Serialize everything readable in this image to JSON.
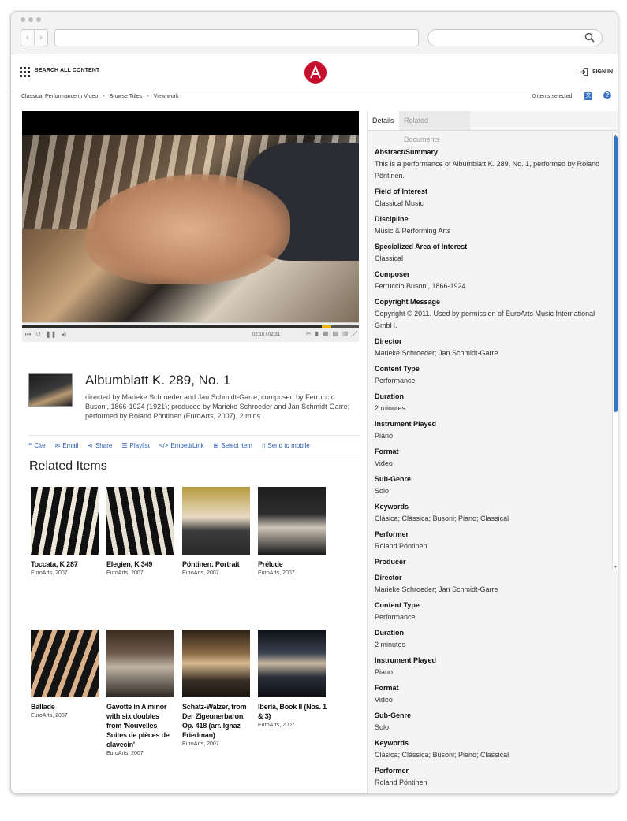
{
  "browser": {
    "url": "",
    "search": ""
  },
  "header": {
    "search_all": "SEARCH ALL CONTENT",
    "sign_in": "SIGN IN"
  },
  "breadcrumb": [
    "Classical Performance in Video",
    "Browse Titles",
    "View work"
  ],
  "items_selected": "0 items selected",
  "player": {
    "time": "02:18 / 02:31",
    "progress_fraction": 0.914
  },
  "work": {
    "title": "Albumblatt K. 289, No. 1",
    "credits": "directed by Marieke Schroeder and Jan Schmidt-Garre; composed by Ferruccio Busoni, 1866-1924 (1921); produced by Marieke Schroeder and Jan Schmidt-Garre; performed by Roland Pöntinen (EuroArts, 2007), 2 mins"
  },
  "actions": [
    "Cite",
    "Email",
    "Share",
    "Playlist",
    "Embed/Link",
    "Select item",
    "Send to mobile"
  ],
  "related": {
    "heading": "Related Items",
    "items": [
      {
        "title": "Toccata, K 287",
        "sub": "EuroArts, 2007"
      },
      {
        "title": "Elegien, K 349",
        "sub": "EuroArts, 2007"
      },
      {
        "title": "Pöntinen: Portrait",
        "sub": "EuroArts, 2007"
      },
      {
        "title": "Prélude",
        "sub": "EuroArts, 2007"
      },
      {
        "title": "Ballade",
        "sub": "EuroArts, 2007"
      },
      {
        "title": "Gavotte in A minor with six doubles from 'Nouvelles Suites de pièces de clavecin'",
        "sub": "EuroArts, 2007"
      },
      {
        "title": "Schatz-Walzer, from Der Zigeunerbaron, Op. 418 (arr. Ignaz Friedman)",
        "sub": "EuroArts, 2007"
      },
      {
        "title": "Iberia, Book II (Nos. 1 & 3)",
        "sub": "EuroArts, 2007"
      }
    ]
  },
  "tabs": {
    "details": "Details",
    "related": "Related Documents"
  },
  "details": [
    {
      "label": "Abstract/Summary",
      "value": "This is a performance of Albumblatt K. 289, No. 1, performed by Roland Pöntinen."
    },
    {
      "label": "Field of Interest",
      "value": "Classical Music"
    },
    {
      "label": "Discipline",
      "value": "Music & Performing Arts"
    },
    {
      "label": "Specialized Area of Interest",
      "value": "Classical"
    },
    {
      "label": "Composer",
      "value": "Ferruccio Busoni, 1866-1924"
    },
    {
      "label": "Copyright Message",
      "value": "Copyright © 2011. Used by permission of EuroArts Music International GmbH."
    },
    {
      "label": "Director",
      "value": "Marieke Schroeder; Jan Schmidt-Garre"
    },
    {
      "label": "Content Type",
      "value": "Performance"
    },
    {
      "label": "Duration",
      "value": "2 minutes"
    },
    {
      "label": "Instrument Played",
      "value": "Piano"
    },
    {
      "label": "Format",
      "value": "Video"
    },
    {
      "label": "Sub-Genre",
      "value": "Solo"
    },
    {
      "label": "Keywords",
      "value": "Clásica; Clássica; Busoni; Piano; Classical"
    },
    {
      "label": "Performer",
      "value": "Roland Pöntinen"
    },
    {
      "label": "Producer",
      "value": ""
    }
  ],
  "details_repeat": [
    {
      "label": "Director",
      "value": "Marieke Schroeder; Jan Schmidt-Garre"
    },
    {
      "label": "Content Type",
      "value": "Performance"
    },
    {
      "label": "Duration",
      "value": "2 minutes"
    },
    {
      "label": "Instrument Played",
      "value": "Piano"
    },
    {
      "label": "Format",
      "value": "Video"
    },
    {
      "label": "Sub-Genre",
      "value": "Solo"
    },
    {
      "label": "Keywords",
      "value": "Clásica; Clássica; Busoni; Piano; Classical"
    },
    {
      "label": "Performer",
      "value": "Roland Pöntinen"
    },
    {
      "label": "Producer",
      "value": ""
    }
  ]
}
